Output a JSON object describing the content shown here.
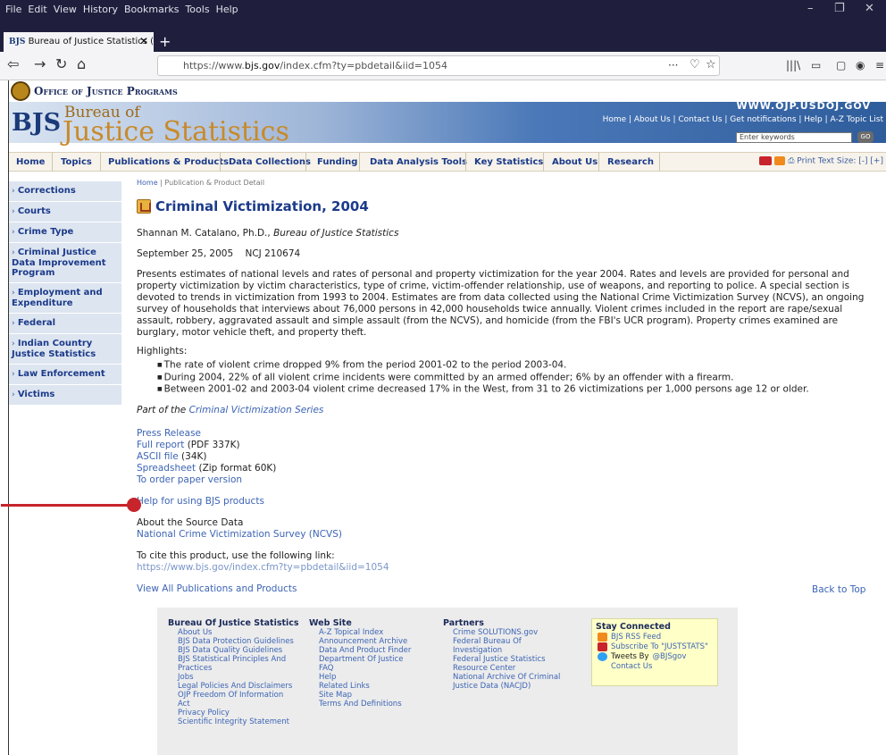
{
  "browser": {
    "menu": [
      "File",
      "Edit",
      "View",
      "History",
      "Bookmarks",
      "Tools",
      "Help"
    ],
    "window_controls": [
      "–",
      "❐",
      "✕"
    ],
    "tab": {
      "favicon": "BJS",
      "title": "Bureau of Justice Statistics (BJS",
      "close": "✕"
    },
    "new_tab": "+",
    "url_prefix": "https://www.",
    "url_domain": "bjs.gov",
    "url_path": "/index.cfm?ty=pbdetail&iid=1054",
    "nav_icons": [
      "back-icon",
      "forward-icon",
      "reload-icon",
      "home-icon"
    ]
  },
  "header": {
    "ojp_title": "Office of Justice Programs",
    "www": "WWW.OJP.USDOJ.GOV",
    "logo_bjs": "BJS",
    "logo_bureau": "Bureau of",
    "logo_stats": "Justice Statistics",
    "top_links": "Home | About Us | Contact Us | Get notifications | Help | A-Z Topic List",
    "search_placeholder": "Enter keywords",
    "go": "GO"
  },
  "mainnav": {
    "items": [
      "Home",
      "Topics",
      "Publications & Products",
      "Data Collections",
      "Funding",
      "Data Analysis Tools",
      "Key Statistics",
      "About Us",
      "Research"
    ],
    "right": "Print  Text Size: [-] [+]"
  },
  "sidebar": [
    "Corrections",
    "Courts",
    "Crime Type",
    "Criminal Justice Data Improvement Program",
    "Employment and Expenditure",
    "Federal",
    "Indian Country Justice Statistics",
    "Law Enforcement",
    "Victims"
  ],
  "content": {
    "crumb_home": "Home",
    "crumb_rest": " | Publication & Product Detail",
    "title": "Criminal Victimization, 2004",
    "author": "Shannan M. Catalano, Ph.D., ",
    "author_org": "Bureau of Justice Statistics",
    "date": "September 25, 2005    NCJ 210674",
    "abstract": "Presents estimates of national levels and rates of personal and property victimization for the year 2004. Rates and levels are provided for personal and property victimization by victim characteristics, type of crime, victim-offender relationship, use of weapons, and reporting to police. A special section is devoted to trends in victimization from 1993 to 2004. Estimates are from data collected using the National Crime Victimization Survey (NCVS), an ongoing survey of households that interviews about 76,000 persons in 42,000 households twice annually. Violent crimes included in the report are rape/sexual assault, robbery, aggravated assault and simple assault (from the NCVS), and homicide (from the FBI's UCR program). Property crimes examined are burglary, motor vehicle theft, and property theft.",
    "highlights_label": "Highlights:",
    "highlights": [
      "The rate of violent crime dropped 9% from the period 2001-02 to the period 2003-04.",
      "During 2004, 22% of all violent crime incidents were committed by an armed offender; 6% by an offender with a firearm.",
      "Between 2001-02 and 2003-04 violent crime decreased 17% in the West, from 31 to 26 victimizations per 1,000 persons age 12 or older."
    ],
    "part_of": "Part of the ",
    "series_link": "Criminal Victimization Series",
    "press_release": "Press Release",
    "full_report": "Full report",
    "full_report_note": " (PDF 337K)",
    "ascii": "ASCII file",
    "ascii_note": " (34K)",
    "spreadsheet": "Spreadsheet",
    "spreadsheet_note": " (Zip format 60K)",
    "paper": "To order paper version",
    "help": "Help for using BJS products",
    "about_source": "About the Source Data",
    "ncvs": "National Crime Victimization Survey (NCVS)",
    "cite_label": "To cite this product, use the following link:",
    "cite_url": "https://www.bjs.gov/index.cfm?ty=pbdetail&iid=1054",
    "view_all": "View All Publications and Products",
    "back_top": "Back to Top"
  },
  "footer": {
    "col1_title": "Bureau Of Justice Statistics",
    "col1": [
      "About Us",
      "BJS Data Protection Guidelines",
      "BJS Data Quality Guidelines",
      "BJS Statistical Principles And",
      "Practices",
      "Jobs",
      "Legal Policies And Disclaimers",
      "OJP Freedom Of Information",
      "Act",
      "Privacy Policy",
      "Scientific Integrity Statement"
    ],
    "col2_title": "Web Site",
    "col2": [
      "A-Z Topical Index",
      "Announcement Archive",
      "Data And Product Finder",
      "Department Of Justice",
      "FAQ",
      "Help",
      "Related Links",
      "Site Map",
      "Terms And Definitions"
    ],
    "col3_title": "Partners",
    "col3": [
      "Crime SOLUTIONS.gov",
      "Federal Bureau Of",
      "Investigation",
      "Federal Justice Statistics",
      "Resource Center",
      "National Archive Of Criminal",
      "Justice Data (NACJD)"
    ],
    "stay_title": "Stay Connected",
    "stay": [
      "BJS RSS Feed",
      "Subscribe To \"JUSTSTATS\"",
      "Tweets By ",
      "Contact Us"
    ],
    "twitter_handle": "@BJSgov"
  }
}
